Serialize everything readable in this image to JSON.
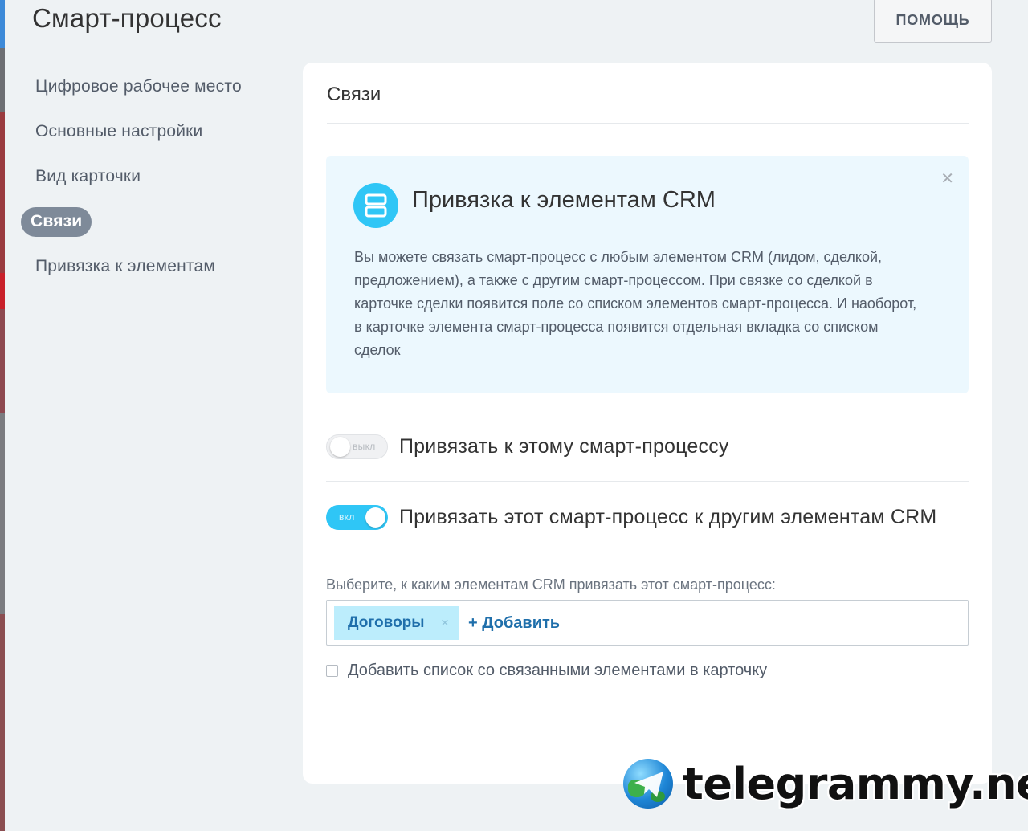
{
  "page": {
    "title": "Смарт-процесс",
    "help_label": "ПОМОЩЬ"
  },
  "sidebar": {
    "items": [
      {
        "label": "Цифровое рабочее место",
        "active": false
      },
      {
        "label": "Основные настройки",
        "active": false
      },
      {
        "label": "Вид карточки",
        "active": false
      },
      {
        "label": "Связи",
        "active": true
      },
      {
        "label": "Привязка к элементам",
        "active": false
      }
    ]
  },
  "card": {
    "title": "Связи",
    "info": {
      "heading": "Привязка к элементам CRM",
      "text": "Вы можете связать смарт-процесс с любым элементом CRM (лидом, сделкой, предложением), а также с другим смарт-процессом. При связке со сделкой в карточке сделки появится поле со списком элементов смарт-процесса. И наоборот, в карточке элемента смарт-процесса появится отдельная вкладка со списком сделок",
      "icon": "crm-elements-icon",
      "close_icon": "close-icon"
    },
    "toggles": [
      {
        "state_label": "выкл",
        "on": false,
        "text": "Привязать к этому смарт-процессу"
      },
      {
        "state_label": "вкл",
        "on": true,
        "text": "Привязать этот смарт-процесс к другим элементам CRM"
      }
    ],
    "select": {
      "label": "Выберите, к каким элементам CRM привязать этот смарт-процесс:",
      "tags": [
        {
          "label": "Договоры",
          "remove": "×"
        }
      ],
      "add_label": "+ Добавить"
    },
    "checkbox": {
      "label": "Добавить список со связанными элементами в карточку",
      "checked": false
    }
  },
  "watermark": {
    "text": "telegrammy.net"
  },
  "colors": {
    "accent": "#2fc6f6",
    "link": "#1f6fab",
    "info_bg": "#ecf8fe",
    "active_pill": "#7e8a99"
  }
}
